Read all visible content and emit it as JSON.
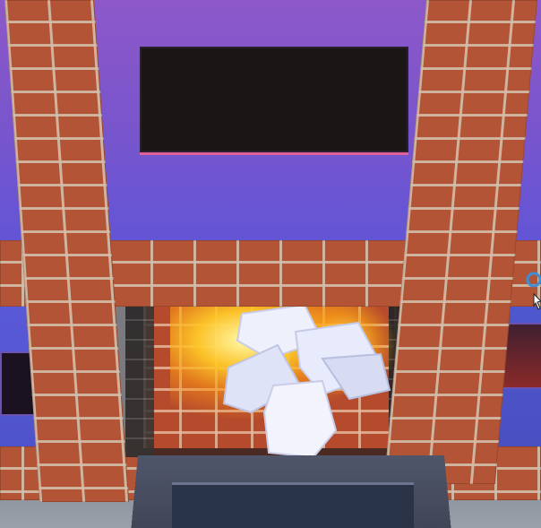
{
  "scene": {
    "description_colors": {
      "wall_top": "#8d58c9",
      "wall_low": "#5058d0",
      "brick": "#b35436",
      "mortar": "#d2bea9",
      "fire_core": "#fff6aa",
      "fire_outer": "#ff9614",
      "logs": "#eef0ff",
      "floor": "#8f96a2",
      "hearth_step": "#4a5066",
      "vent": "#2a3448"
    },
    "icons": [
      "fireplace",
      "fire",
      "logs",
      "cursor-arrow-icon"
    ]
  }
}
